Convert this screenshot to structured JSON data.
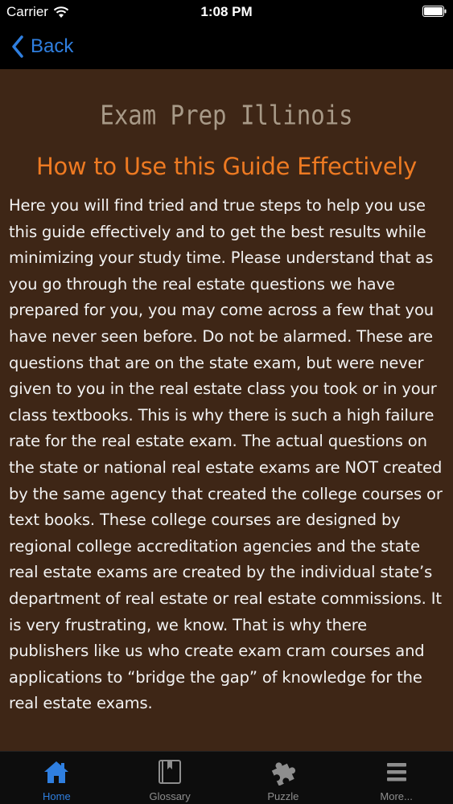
{
  "status_bar": {
    "carrier": "Carrier",
    "time": "1:08 PM"
  },
  "nav": {
    "back_label": "Back"
  },
  "content": {
    "app_title": "Exam Prep Illinois",
    "heading": "How to Use this Guide Effectively",
    "body": "Here you will find tried and true steps to help you use this guide effectively and to get the best results while minimizing your study time. Please understand that as you go through the real estate questions we have prepared for you, you may come across a few that you have never seen before. Do not be alarmed. These are questions that are on the state exam, but were never given to you in the real estate class you took or in your class textbooks. This is why there is such a high failure rate for the real estate exam. The actual questions on the state or national real estate exams are NOT created by the same agency that created the college courses or text books. These college courses are designed by regional college accreditation agencies and the state real estate exams are created by the individual state’s department of real estate or real estate commissions. It is very frustrating, we know. That is why there publishers like us who create exam cram courses and applications to “bridge the gap” of knowledge for the real estate exams."
  },
  "tabs": [
    {
      "label": "Home",
      "icon": "home-icon",
      "active": true
    },
    {
      "label": "Glossary",
      "icon": "book-icon",
      "active": false
    },
    {
      "label": "Puzzle",
      "icon": "puzzle-icon",
      "active": false
    },
    {
      "label": "More...",
      "icon": "menu-icon",
      "active": false
    }
  ],
  "colors": {
    "accent": "#2f7fe0",
    "content_background": "#3e2616",
    "heading": "#ee7a22"
  }
}
